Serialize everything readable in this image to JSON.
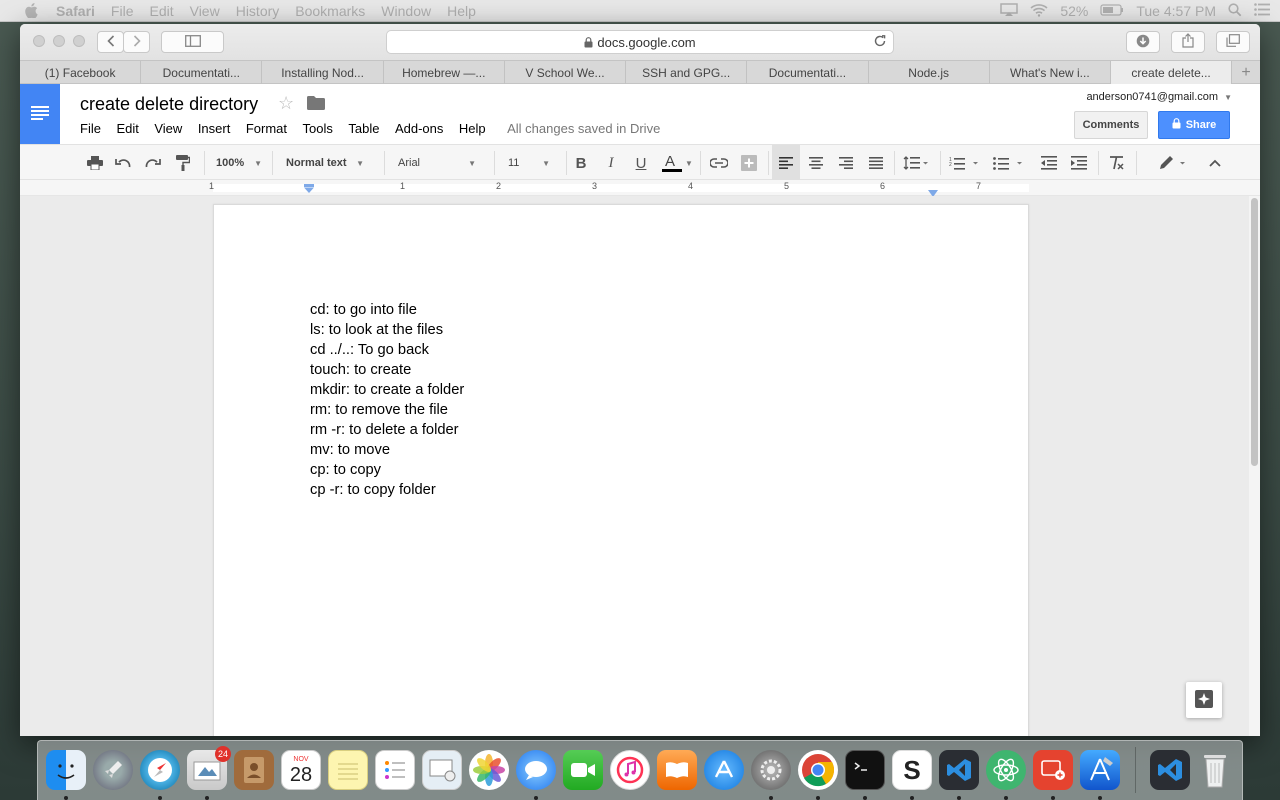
{
  "menubar": {
    "app": "Safari",
    "items": [
      "File",
      "Edit",
      "View",
      "History",
      "Bookmarks",
      "Window",
      "Help"
    ],
    "battery": "52%",
    "clock": "Tue 4:57 PM"
  },
  "browser": {
    "url": "docs.google.com",
    "tabs": [
      "(1) Facebook",
      "Documentati...",
      "Installing Nod...",
      "Homebrew —...",
      "V School We...",
      "SSH and GPG...",
      "Documentati...",
      "Node.js",
      "What's New i...",
      "create delete..."
    ]
  },
  "docs": {
    "title": "create delete directory",
    "menus": [
      "File",
      "Edit",
      "View",
      "Insert",
      "Format",
      "Tools",
      "Table",
      "Add-ons",
      "Help"
    ],
    "save_status": "All changes saved in Drive",
    "account": "anderson0741@gmail.com",
    "comments_label": "Comments",
    "share_label": "Share",
    "toolbar": {
      "zoom": "100%",
      "style": "Normal text",
      "font": "Arial",
      "size": "11"
    },
    "ruler_numbers": [
      "1",
      "1",
      "2",
      "3",
      "4",
      "5",
      "6",
      "7"
    ],
    "lines": [
      "cd: to go into file",
      "ls: to look at the files",
      "cd ../..: To go back",
      "touch: to create",
      "mkdir: to create a folder",
      "rm: to remove the file",
      "rm -r: to delete a folder",
      "mv: to move",
      "cp: to copy",
      "cp -r: to copy folder"
    ]
  },
  "dock": {
    "mail_badge": "24",
    "calendar_month": "NOV",
    "calendar_day": "28"
  }
}
